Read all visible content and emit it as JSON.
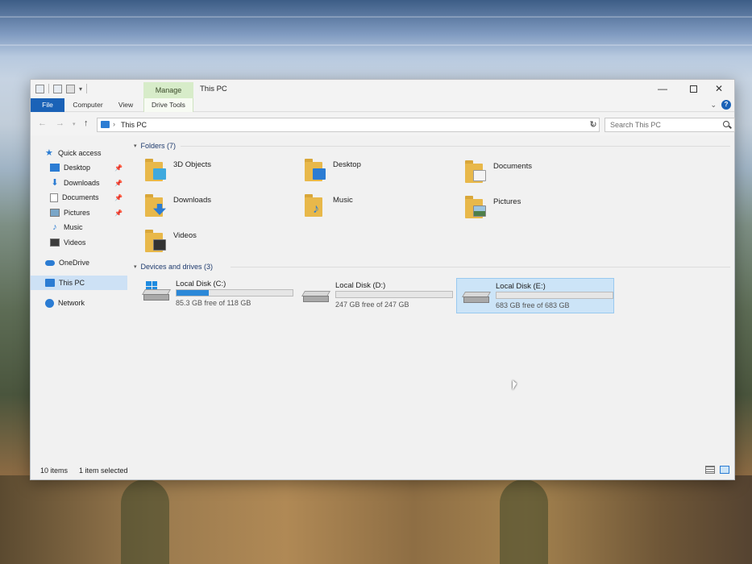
{
  "window": {
    "title": "This PC",
    "manage_label": "Manage",
    "controls": {
      "minimize": "—",
      "close": "✕"
    }
  },
  "ribbon": {
    "tabs": [
      "File",
      "Computer",
      "View",
      "Drive Tools"
    ]
  },
  "navigation": {
    "address": "This PC",
    "search_placeholder": "Search This PC"
  },
  "sidebar": {
    "quick_access": "Quick access",
    "items": [
      {
        "label": "Desktop",
        "pinned": true
      },
      {
        "label": "Downloads",
        "pinned": true
      },
      {
        "label": "Documents",
        "pinned": true
      },
      {
        "label": "Pictures",
        "pinned": true
      },
      {
        "label": "Music",
        "pinned": false
      },
      {
        "label": "Videos",
        "pinned": false
      }
    ],
    "onedrive": "OneDrive",
    "this_pc": "This PC",
    "network": "Network"
  },
  "content": {
    "folders_header": "Folders (7)",
    "folders": [
      {
        "label": "3D Objects",
        "icon": "3d-objects-folder-icon",
        "overlay_color": "#3fa9de"
      },
      {
        "label": "Desktop",
        "icon": "desktop-folder-icon",
        "overlay_color": "#2b7cd3"
      },
      {
        "label": "Documents",
        "icon": "documents-folder-icon",
        "overlay_color": "#f4f4f4"
      },
      {
        "label": "Downloads",
        "icon": "downloads-folder-icon",
        "overlay_color": "#2b7cd3"
      },
      {
        "label": "Music",
        "icon": "music-folder-icon",
        "overlay_color": "#2b7cd3"
      },
      {
        "label": "Pictures",
        "icon": "pictures-folder-icon",
        "overlay_color": "#6a9fc4"
      },
      {
        "label": "Videos",
        "icon": "videos-folder-icon",
        "overlay_color": "#333333"
      }
    ],
    "drives_header": "Devices and drives (3)",
    "drives": [
      {
        "name": "Local Disk (C:)",
        "free": "85.3 GB free of 118 GB",
        "used_fraction": 0.28,
        "windows": true,
        "selected": false
      },
      {
        "name": "Local Disk (D:)",
        "free": "247 GB free of 247 GB",
        "used_fraction": 0.0,
        "windows": false,
        "selected": false
      },
      {
        "name": "Local Disk (E:)",
        "free": "683 GB free of 683 GB",
        "used_fraction": 0.0,
        "windows": false,
        "selected": true
      }
    ]
  },
  "status": {
    "items": "10 items",
    "selected": "1 item selected"
  },
  "colors": {
    "accent": "#2b7cd3",
    "manage_tab": "#d7ecc9",
    "folder": "#e8b84a",
    "selection": "#cce4f7"
  }
}
